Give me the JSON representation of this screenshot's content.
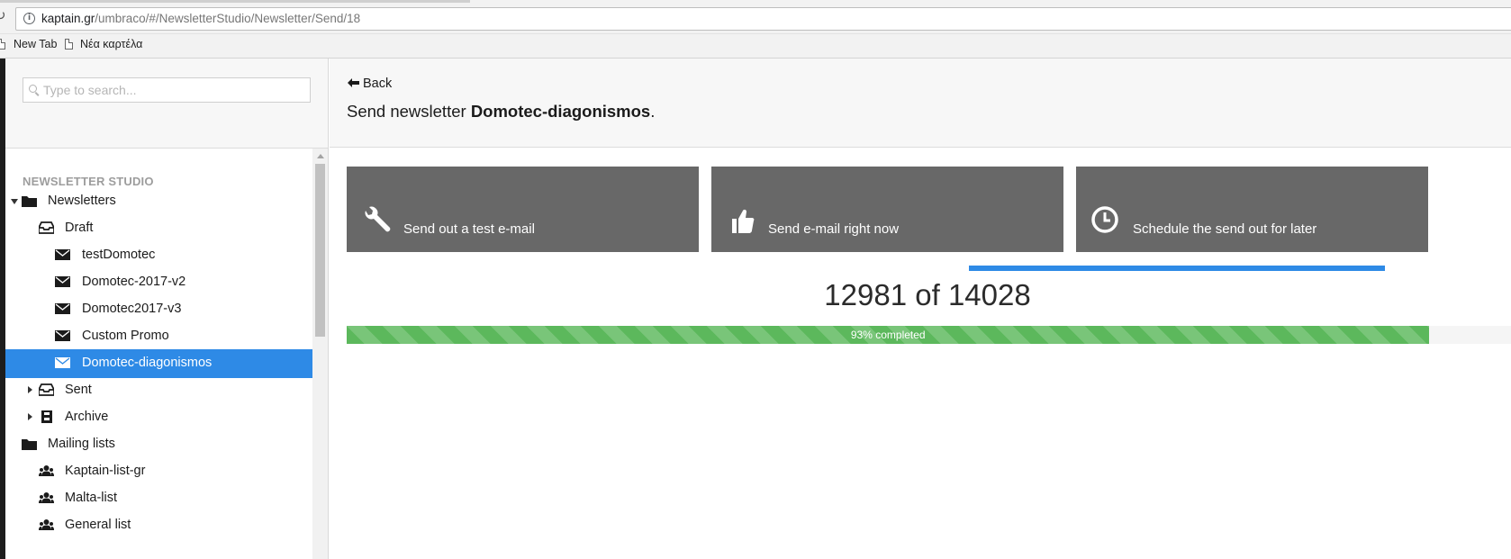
{
  "browser": {
    "url_host": "kaptain.gr",
    "url_path": "/umbraco/#/NewsletterStudio/Newsletter/Send/18",
    "bookmarks": [
      "New Tab",
      "Νέα καρτέλα"
    ]
  },
  "sidebar": {
    "search_placeholder": "Type to search...",
    "section_title": "NEWSLETTER STUDIO",
    "tree": [
      {
        "label": "Newsletters",
        "icon": "folder-icon",
        "expanded": true
      },
      {
        "label": "Draft",
        "icon": "inbox-icon",
        "expanded": true
      },
      {
        "label": "testDomotec",
        "icon": "envelope-icon"
      },
      {
        "label": "Domotec-2017-v2",
        "icon": "envelope-icon"
      },
      {
        "label": "Domotec2017-v3",
        "icon": "envelope-icon"
      },
      {
        "label": "Custom Promo",
        "icon": "envelope-icon"
      },
      {
        "label": "Domotec-diagonismos",
        "icon": "envelope-icon",
        "selected": true
      },
      {
        "label": "Sent",
        "icon": "inbox-icon",
        "expanded": false
      },
      {
        "label": "Archive",
        "icon": "archive-icon",
        "expanded": false
      },
      {
        "label": "Mailing lists",
        "icon": "folder-icon",
        "expanded": true
      },
      {
        "label": "Kaptain-list-gr",
        "icon": "users-icon"
      },
      {
        "label": "Malta-list",
        "icon": "users-icon"
      },
      {
        "label": "General list",
        "icon": "users-icon"
      }
    ]
  },
  "header": {
    "back_label": "Back",
    "title_prefix": "Send newsletter ",
    "newsletter_name": "Domotec-diagonismos",
    "title_suffix": "."
  },
  "actions": [
    {
      "label": "Send out a test e-mail",
      "icon": "wrench-icon"
    },
    {
      "label": "Send e-mail right now",
      "icon": "thumbs-up-icon"
    },
    {
      "label": "Schedule the send out for later",
      "icon": "clock-icon"
    }
  ],
  "progress": {
    "sent": "12981",
    "of_word": "of",
    "total": "14028",
    "percent": 0.93,
    "label": "93% completed"
  },
  "colors": {
    "selected": "#2e8ae6",
    "button_bg": "#686868",
    "progress_fill": "#5cb85c",
    "accent_line": "#2e8ae6"
  }
}
